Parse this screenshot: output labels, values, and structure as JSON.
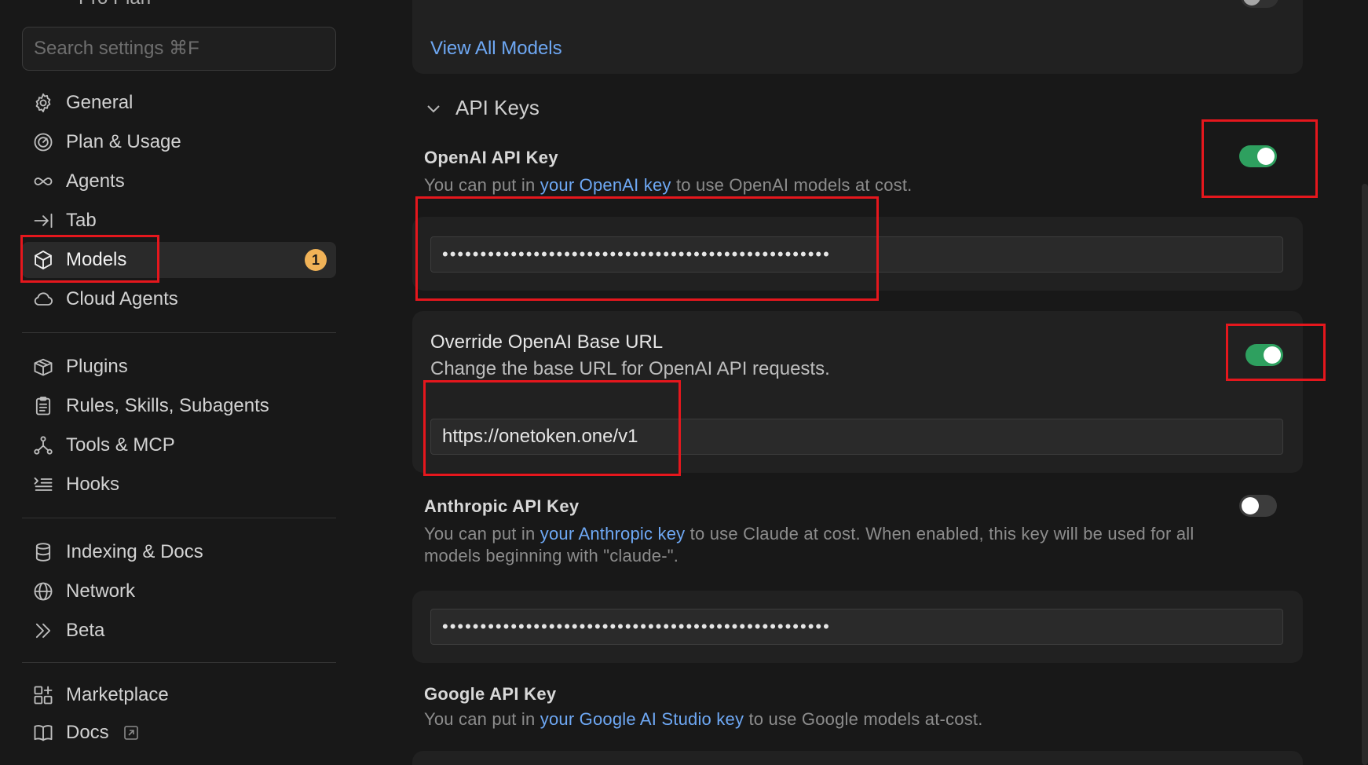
{
  "sidebar": {
    "plan_label": "Pro Plan",
    "search_placeholder": "Search settings ⌘F",
    "items": [
      {
        "label": "General",
        "icon": "gear-icon"
      },
      {
        "label": "Plan & Usage",
        "icon": "gauge-icon"
      },
      {
        "label": "Agents",
        "icon": "infinity-icon"
      },
      {
        "label": "Tab",
        "icon": "tab-arrow-icon"
      },
      {
        "label": "Models",
        "icon": "cube-icon",
        "active": true,
        "badge": "1"
      },
      {
        "label": "Cloud Agents",
        "icon": "cloud-icon"
      },
      {
        "label": "Plugins",
        "icon": "box-icon"
      },
      {
        "label": "Rules, Skills, Subagents",
        "icon": "clipboard-icon"
      },
      {
        "label": "Tools & MCP",
        "icon": "nodes-icon"
      },
      {
        "label": "Hooks",
        "icon": "list-icon"
      },
      {
        "label": "Indexing & Docs",
        "icon": "database-icon"
      },
      {
        "label": "Network",
        "icon": "globe-icon"
      },
      {
        "label": "Beta",
        "icon": "chevrons-right-icon"
      },
      {
        "label": "Marketplace",
        "icon": "grid-plus-icon"
      },
      {
        "label": "Docs",
        "icon": "book-icon",
        "external": true
      }
    ]
  },
  "main": {
    "view_all_models": "View All Models",
    "api_keys_section": "API Keys",
    "openai": {
      "title": "OpenAI API Key",
      "desc_before": "You can put in ",
      "desc_link": "your OpenAI key",
      "desc_after": " to use OpenAI models at cost.",
      "enabled": true,
      "value": "•••••••••••••••••••••••••••••••••••••••••••••••••••"
    },
    "override": {
      "title": "Override OpenAI Base URL",
      "desc": "Change the base URL for OpenAI API requests.",
      "enabled": true,
      "value": "https://onetoken.one/v1"
    },
    "anthropic": {
      "title": "Anthropic API Key",
      "desc_before": "You can put in ",
      "desc_link": "your Anthropic key",
      "desc_after": " to use Claude at cost. When enabled, this key will be used for all",
      "desc_line2": "models beginning with \"claude-\".",
      "enabled": false,
      "value": "•••••••••••••••••••••••••••••••••••••••••••••••••••"
    },
    "google": {
      "title": "Google API Key",
      "desc_before": "You can put in ",
      "desc_link": "your Google AI Studio key",
      "desc_after": " to use Google models at-cost."
    }
  },
  "colors": {
    "accent_link": "#6ea8f4",
    "toggle_on": "#2ea05f",
    "badge": "#f0b257",
    "highlight": "#e5171d"
  }
}
